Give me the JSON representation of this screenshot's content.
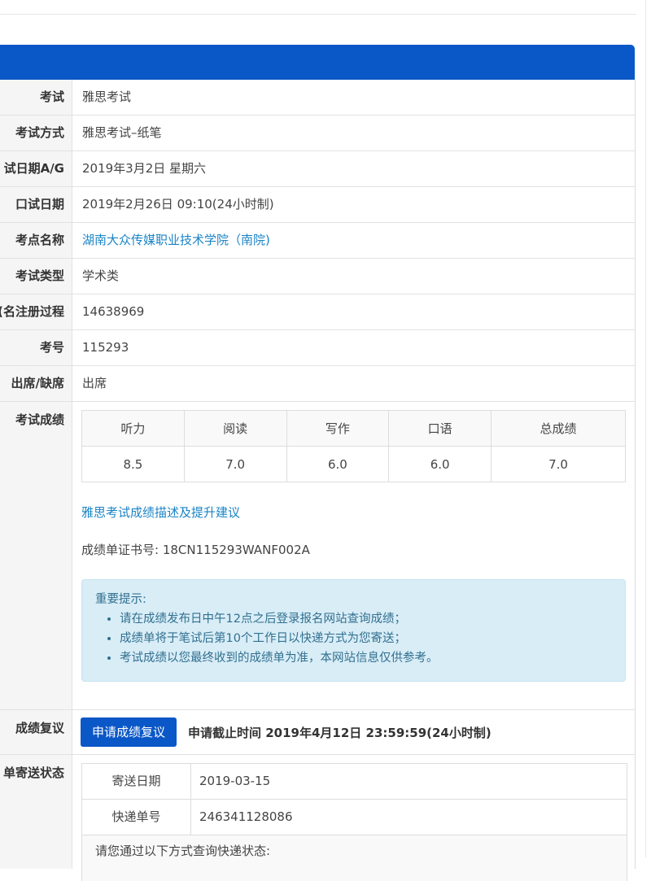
{
  "rows": {
    "exam": {
      "label": "考试",
      "value": "雅思考试"
    },
    "mode": {
      "label": "考试方式",
      "value": "雅思考试–纸笔"
    },
    "date": {
      "label": "试日期A/G",
      "value": "2019年3月2日 星期六"
    },
    "speaking": {
      "label": "口试日期",
      "value": "2019年2月26日 09:10(24小时制)"
    },
    "center": {
      "label": "考点名称",
      "value": "湖南大众传媒职业技术学院（南院)"
    },
    "type": {
      "label": "考试类型",
      "value": "学术类"
    },
    "reg": {
      "label": "名注册过程)",
      "value": "14638969"
    },
    "number": {
      "label": "考号",
      "value": "115293"
    },
    "attendance": {
      "label": "出席/缺席",
      "value": "出席"
    }
  },
  "scores": {
    "label": "考试成绩",
    "headers": [
      "听力",
      "阅读",
      "写作",
      "口语",
      "总成绩"
    ],
    "values": [
      "8.5",
      "7.0",
      "6.0",
      "6.0",
      "7.0"
    ],
    "link": "雅思考试成绩描述及提升建议",
    "cert": "成绩单证书号: 18CN115293WANF002A",
    "notice_title": "重要提示:",
    "notice_items": [
      "请在成绩发布日中午12点之后登录报名网站查询成绩；",
      "成绩单将于笔试后第10个工作日以快递方式为您寄送；",
      "考试成绩以您最终收到的成绩单为准，本网站信息仅供参考。"
    ]
  },
  "review": {
    "label": "成绩复议",
    "button": "申请成绩复议",
    "deadline": "申请截止时间 2019年4月12日 23:59:59(24小时制)"
  },
  "shipping": {
    "label": "单寄送状态",
    "date_label": "寄送日期",
    "date_value": "2019-03-15",
    "track_label": "快递单号",
    "track_value": "246341128086",
    "note": "请您通过以下方式查询快递状态:"
  },
  "colors": {
    "header_blue": "#0a57c7",
    "link": "#1a84c6",
    "notice_bg": "#d9edf7"
  }
}
